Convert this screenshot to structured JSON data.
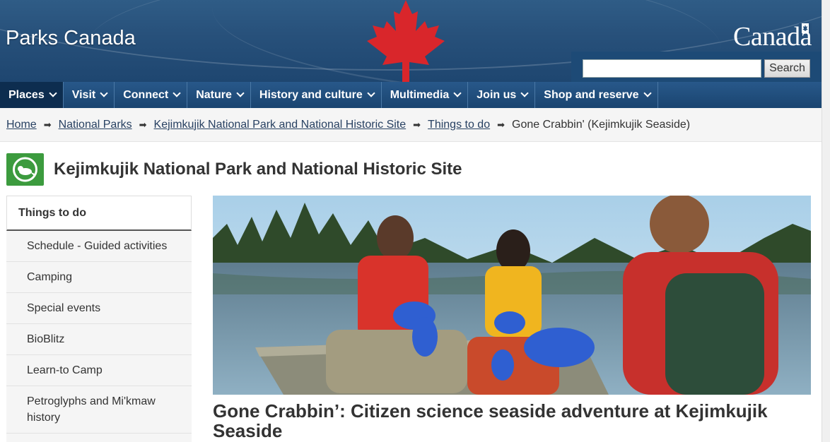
{
  "header": {
    "site_title": "Parks Canada",
    "wordmark": "Canadä",
    "search_placeholder": "",
    "search_button": "Search"
  },
  "nav": [
    {
      "label": "Places",
      "active": true
    },
    {
      "label": "Visit"
    },
    {
      "label": "Connect"
    },
    {
      "label": "Nature"
    },
    {
      "label": "History and culture"
    },
    {
      "label": "Multimedia"
    },
    {
      "label": "Join us"
    },
    {
      "label": "Shop and reserve"
    }
  ],
  "breadcrumb": {
    "links": [
      "Home",
      "National Parks",
      "Kejimkujik National Park and National Historic Site",
      "Things to do"
    ],
    "current": "Gone Crabbin' (Kejimkujik Seaside)"
  },
  "park": {
    "title": "Kejimkujik National Park and National Historic Site"
  },
  "sidebar": {
    "heading": "Things to do",
    "items": [
      {
        "label": "Schedule - Guided activities"
      },
      {
        "label": "Camping"
      },
      {
        "label": "Special events"
      },
      {
        "label": "BioBlitz"
      },
      {
        "label": "Learn-to Camp"
      },
      {
        "label": "Petroglyphs and Mi'kmaw history"
      }
    ]
  },
  "feature": {
    "title": "Gone Crabbin’: Citizen science seaside adventure at Kejimkujik Seaside"
  },
  "colors": {
    "banner": "#27507a",
    "nav": "#1e4b78",
    "nav_active": "#0d2d4f",
    "leaf": "#d9262b",
    "park_logo": "#3c9b3e",
    "link": "#284162"
  }
}
